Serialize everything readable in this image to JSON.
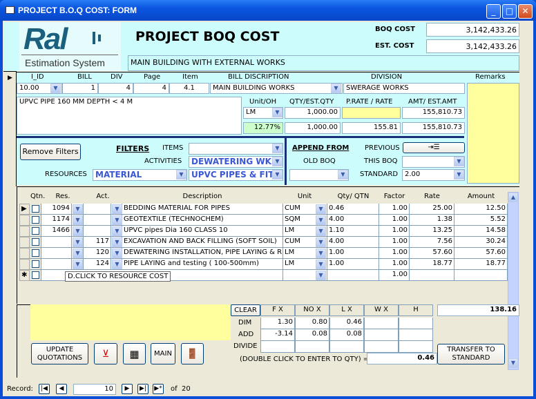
{
  "window": {
    "title": "PROJECT B.O.Q COST: FORM",
    "minimize": "_",
    "maximize": "□",
    "close": "✕"
  },
  "header": {
    "logo_text": "Ral",
    "logo_subtitle": "Estimation System",
    "title": "PROJECT BOQ COST",
    "project_name": "MAIN BUILDING WITH EXTERNAL WORKS",
    "boq_cost_label": "BOQ COST",
    "boq_cost": "3,142,433.26",
    "est_cost_label": "EST. COST",
    "est_cost": "3,142,433.26"
  },
  "item": {
    "headers": {
      "i_id": "I_ID",
      "bill": "BILL",
      "div": "DIV",
      "page": "Page",
      "item": "Item",
      "bill_desc": "BILL DISCRIPTION",
      "division": "DIVISION",
      "remarks": "Remarks",
      "unit_oh": "Unit/OH",
      "qty": "QTY/EST.QTY",
      "rate": "P.RATE / RATE",
      "amt": "AMT/ EST.AMT"
    },
    "i_id": "10.00",
    "bill": "1",
    "div": "4",
    "page": "4",
    "item_no": "4.1",
    "bill_desc": "MAIN BUILDING WORKS",
    "division": "SWERAGE WORKS",
    "description": "UPVC PIPE 160 MM DEPTH < 4 M",
    "unit": "LM",
    "overhead": "12.77%",
    "qty": "1,000.00",
    "est_qty": "1,000.00",
    "p_rate": "",
    "rate": "155.81",
    "amt": "155,810.73",
    "est_amt": "155,810.73"
  },
  "filters": {
    "remove_label": "Remove Filters",
    "title": "FILTERS",
    "items_label": "ITEMS",
    "items_value": "",
    "activities_label": "ACTIVITIES",
    "activities_value": "DEWATERING WKS",
    "resources_label": "RESOURCES",
    "resources_value": "MATERIAL",
    "resources_sub_value": "UPVC PIPES & FITT"
  },
  "append": {
    "title": "APPEND FROM",
    "old_boq_label": "OLD BOQ",
    "old_boq_value": "",
    "previous_label": "PREVIOUS",
    "this_boq_label": "THIS BOQ",
    "this_boq_value": "",
    "standard_label": "STANDARD",
    "standard_value": "2.00"
  },
  "resources_table": {
    "columns": [
      "Qtn.",
      "Res.",
      "Act.",
      "Description",
      "Unit",
      "Qty/ QTN",
      "Factor",
      "Rate",
      "Amount"
    ],
    "rows": [
      {
        "res": "1094",
        "act": "",
        "desc": "BEDDING MATERIAL FOR PIPES",
        "unit": "CUM",
        "qty": "0.46",
        "factor": "1.00",
        "rate": "25.00",
        "amount": "12.50"
      },
      {
        "res": "1174",
        "act": "",
        "desc": "GEOTEXTILE (TECHNOCHEM)",
        "unit": "SQM",
        "qty": "4.00",
        "factor": "1.00",
        "rate": "1.38",
        "amount": "5.52"
      },
      {
        "res": "1466",
        "act": "",
        "desc": "UPVC pipes Dia  160 CLASS 10",
        "unit": "LM",
        "qty": "1.10",
        "factor": "1.00",
        "rate": "13.25",
        "amount": "14.58"
      },
      {
        "res": "",
        "act": "117",
        "desc": "EXCAVATION AND BACK FILLING (SOFT SOIL)",
        "unit": "CUM",
        "qty": "4.00",
        "factor": "1.00",
        "rate": "7.56",
        "amount": "30.24"
      },
      {
        "res": "",
        "act": "120",
        "desc": "DEWATERING INSTALLATION, PIPE LAYING & R",
        "unit": "LM",
        "qty": "1.00",
        "factor": "1.00",
        "rate": "57.60",
        "amount": "57.60"
      },
      {
        "res": "",
        "act": "124",
        "desc": "PIPE LAYING and testing ( 100-500mm)",
        "unit": "LM",
        "qty": "1.00",
        "factor": "1.00",
        "rate": "18.77",
        "amount": "18.77"
      }
    ],
    "new_row_factor": "1.00",
    "tooltip": "D.CLICK TO RESOURCE COST"
  },
  "calc": {
    "clear_label": "CLEAR",
    "headers": [
      "F X",
      "NO  X",
      "L  X",
      "W  X",
      "H"
    ],
    "total": "138.16",
    "rows": [
      {
        "label": "DIM",
        "values": [
          "1.30",
          "0.80",
          "0.46",
          "",
          ""
        ]
      },
      {
        "label": "ADD",
        "values": [
          "-3.14",
          "0.08",
          "0.08",
          "",
          ""
        ]
      },
      {
        "label": "DIVIDE",
        "values": [
          "",
          "",
          "",
          "",
          ""
        ]
      }
    ],
    "result_label": "(DOUBLE CLICK TO ENTER TO QTY) =",
    "result": "0.46",
    "transfer_label": "TRANSFER TO STANDARD"
  },
  "buttons": {
    "update_quotations": "UPDATE QUOTATIONS",
    "main": "MAIN"
  },
  "nav": {
    "label": "Record:",
    "current": "10",
    "of_label": "of",
    "total": "20"
  }
}
